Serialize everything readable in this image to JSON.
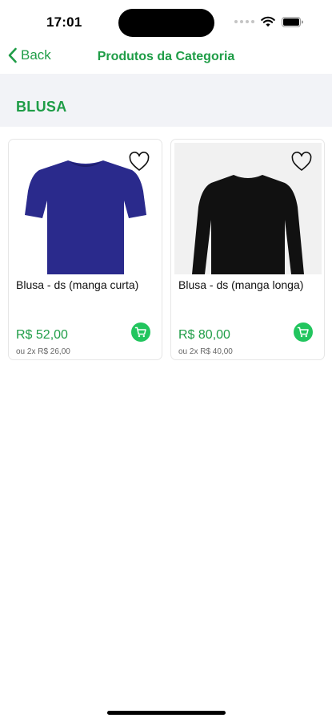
{
  "status": {
    "time": "17:01"
  },
  "nav": {
    "back_label": "Back",
    "title": "Produtos da Categoria"
  },
  "category": {
    "title": "BLUSA"
  },
  "products": [
    {
      "name": "Blusa - ds (manga curta)",
      "price": "R$ 52,00",
      "installment": "ou 2x R$ 26,00",
      "image": "blue-short-sleeve-tshirt"
    },
    {
      "name": "Blusa - ds (manga longa)",
      "price": "R$ 80,00",
      "installment": "ou 2x R$ 40,00",
      "image": "black-long-sleeve-shirt"
    }
  ],
  "colors": {
    "accent": "#1f9d47",
    "cart": "#22c55e",
    "header_bg": "#f2f3f7",
    "shirt_blue": "#2a2a8c",
    "shirt_black": "#111111"
  }
}
